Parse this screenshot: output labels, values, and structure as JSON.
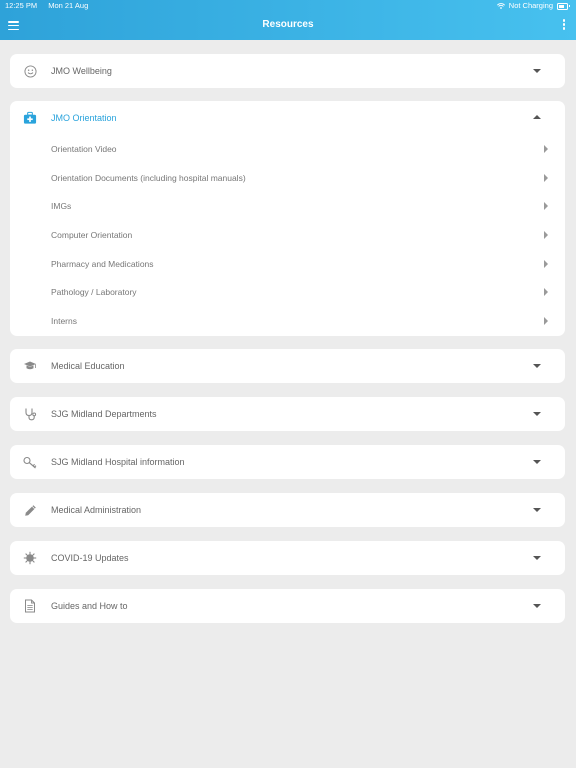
{
  "status_bar": {
    "time": "12:25 PM",
    "date": "Mon 21 Aug",
    "charging": "Not Charging"
  },
  "header": {
    "title": "Resources"
  },
  "sections": [
    {
      "title": "JMO Wellbeing",
      "icon": "smiley-icon"
    },
    {
      "title": "JMO Orientation",
      "icon": "first-aid-icon",
      "items": [
        "Orientation Video",
        "Orientation Documents (including hospital manuals)",
        "IMGs",
        "Computer Orientation",
        "Pharmacy and Medications",
        "Pathology / Laboratory",
        "Interns"
      ]
    },
    {
      "title": "Medical Education",
      "icon": "graduation-cap-icon"
    },
    {
      "title": "SJG Midland Departments",
      "icon": "stethoscope-icon"
    },
    {
      "title": "SJG Midland Hospital information",
      "icon": "key-icon"
    },
    {
      "title": "Medical Administration",
      "icon": "pencil-icon"
    },
    {
      "title": "COVID-19 Updates",
      "icon": "virus-icon"
    },
    {
      "title": "Guides and How to",
      "icon": "document-icon"
    }
  ],
  "colors": {
    "accent": "#29a3dc",
    "nav_start": "#2ea2d9",
    "nav_end": "#47c1ef",
    "background": "#ececec"
  }
}
